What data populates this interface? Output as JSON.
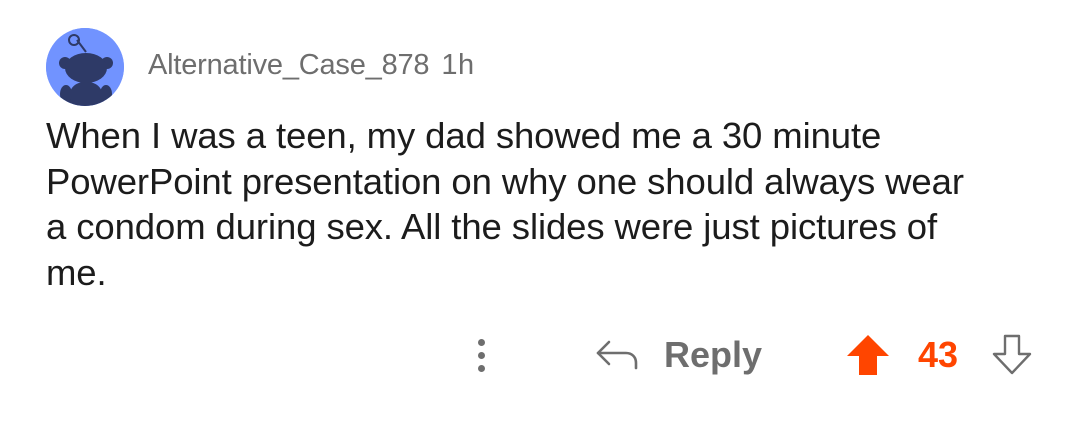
{
  "comment": {
    "username": "Alternative_Case_878",
    "timestamp": "1h",
    "avatar_icon": "snoo-avatar-icon",
    "body_lines": [
      "When I was a teen, my dad showed me a 30 minute",
      "PowerPoint presentation on why one should always wear",
      "a condom during sex. All the slides were just pictures of",
      "me."
    ]
  },
  "actions": {
    "more_icon": "vertical-ellipsis-icon",
    "reply_icon": "reply-arrow-icon",
    "reply_label": "Reply",
    "upvote_icon": "upvote-arrow-icon",
    "score": "43",
    "downvote_icon": "downvote-arrow-icon"
  },
  "colors": {
    "avatar_background": "#7193ff",
    "upvote_active": "#ff4500",
    "muted_text": "#6e6e6e",
    "body_text": "#1c1c1c"
  }
}
